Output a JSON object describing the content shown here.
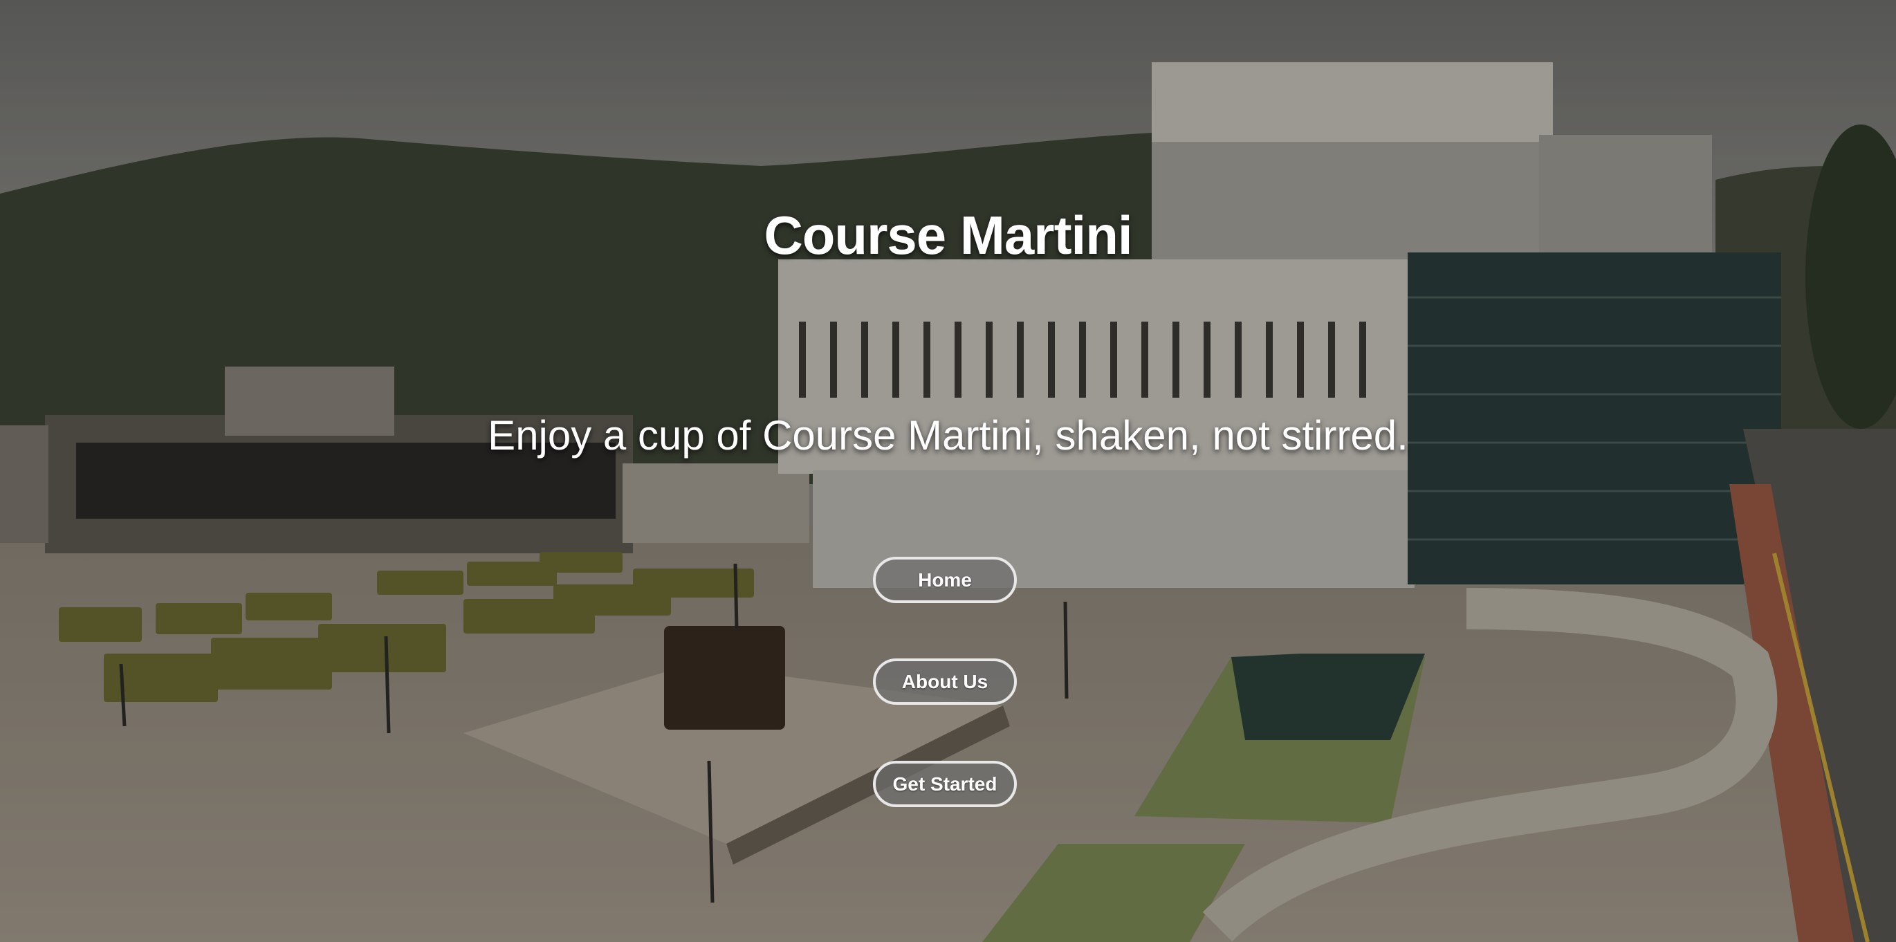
{
  "hero": {
    "title": "Course Martini",
    "tagline": "Enjoy a cup of Course Martini, shaken, not stirred."
  },
  "nav": {
    "home_label": "Home",
    "about_label": "About Us",
    "get_started_label": "Get Started"
  },
  "colors": {
    "text": "#ffffff",
    "button_bg": "#6e6e6e",
    "button_border": "#e8e8e8"
  }
}
